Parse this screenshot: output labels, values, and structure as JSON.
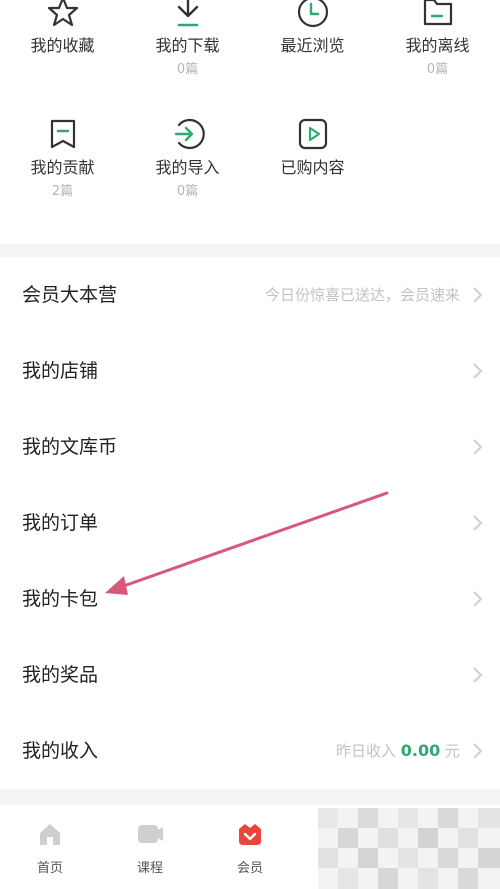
{
  "grid": [
    {
      "label": "我的收藏",
      "count": "",
      "icon": "star-icon"
    },
    {
      "label": "我的下载",
      "count": "0篇",
      "icon": "download-icon"
    },
    {
      "label": "最近浏览",
      "count": "",
      "icon": "clock-icon"
    },
    {
      "label": "我的离线",
      "count": "0篇",
      "icon": "folder-icon"
    },
    {
      "label": "我的贡献",
      "count": "2篇",
      "icon": "contribute-icon"
    },
    {
      "label": "我的导入",
      "count": "0篇",
      "icon": "import-icon"
    },
    {
      "label": "已购内容",
      "count": "",
      "icon": "play-icon"
    }
  ],
  "menu": [
    {
      "label": "会员大本营",
      "hint": "今日份惊喜已送达，会员速来"
    },
    {
      "label": "我的店铺"
    },
    {
      "label": "我的文库币"
    },
    {
      "label": "我的订单"
    },
    {
      "label": "我的卡包"
    },
    {
      "label": "我的奖品"
    },
    {
      "label": "我的收入",
      "hint_prefix": "昨日收入 ",
      "value": "0.00",
      "suffix": " 元"
    }
  ],
  "tabs": [
    {
      "label": "首页",
      "icon": "home-icon"
    },
    {
      "label": "课程",
      "icon": "course-icon"
    },
    {
      "label": "会员",
      "icon": "vip-icon"
    }
  ],
  "colors": {
    "accent_green": "#2fa970",
    "annotation_arrow": "#d9577c",
    "vip_red": "#e8453c"
  }
}
